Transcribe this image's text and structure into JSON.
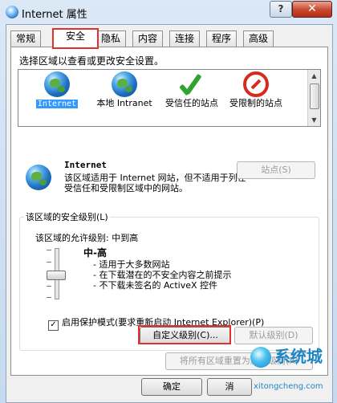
{
  "window": {
    "title": "Internet 属性",
    "help_label": "?",
    "close_label": "✕"
  },
  "tabs": [
    {
      "label": "常规"
    },
    {
      "label": "安全"
    },
    {
      "label": "隐私"
    },
    {
      "label": "内容"
    },
    {
      "label": "连接"
    },
    {
      "label": "程序"
    },
    {
      "label": "高级"
    }
  ],
  "active_tab": "安全",
  "security": {
    "prompt": "选择区域以查看或更改安全设置。",
    "zones": [
      {
        "label": "Internet",
        "icon": "globe-icon",
        "selected": true
      },
      {
        "label": "本地 Intranet",
        "icon": "intranet-globe-icon"
      },
      {
        "label": "受信任的站点",
        "icon": "green-check-icon"
      },
      {
        "label": "受限制的站点",
        "icon": "no-entry-icon"
      }
    ],
    "zone_title": "Internet",
    "zone_desc": "该区域适用于 Internet 网站，但不适用于列在受信任和受限制区域中的网站。",
    "sites_button": "站点(S)",
    "group_title": "该区域的安全级别(L)",
    "allowed_label": "该区域的允许级别: 中到高",
    "level_name": "中-高",
    "level_bullets": [
      "- 适用于大多数网站",
      "- 在下载潜在的不安全内容之前提示",
      "- 不下载未签名的 ActiveX 控件"
    ],
    "protected_mode_label": "启用保护模式(要求重新启动 Internet Explorer)(P)",
    "protected_mode_checked": true,
    "custom_level_button": "自定义级别(C)...",
    "default_level_button": "默认级别(D)",
    "reset_all_button": "将所有区域重置为默认级别(R)"
  },
  "footer": {
    "ok_button": "确定",
    "cancel_button": "消"
  },
  "watermark": {
    "text": "系统城",
    "url": "xitongcheng.com"
  },
  "colors": {
    "highlight_box": "#e03030",
    "selection": "#3399ff"
  }
}
